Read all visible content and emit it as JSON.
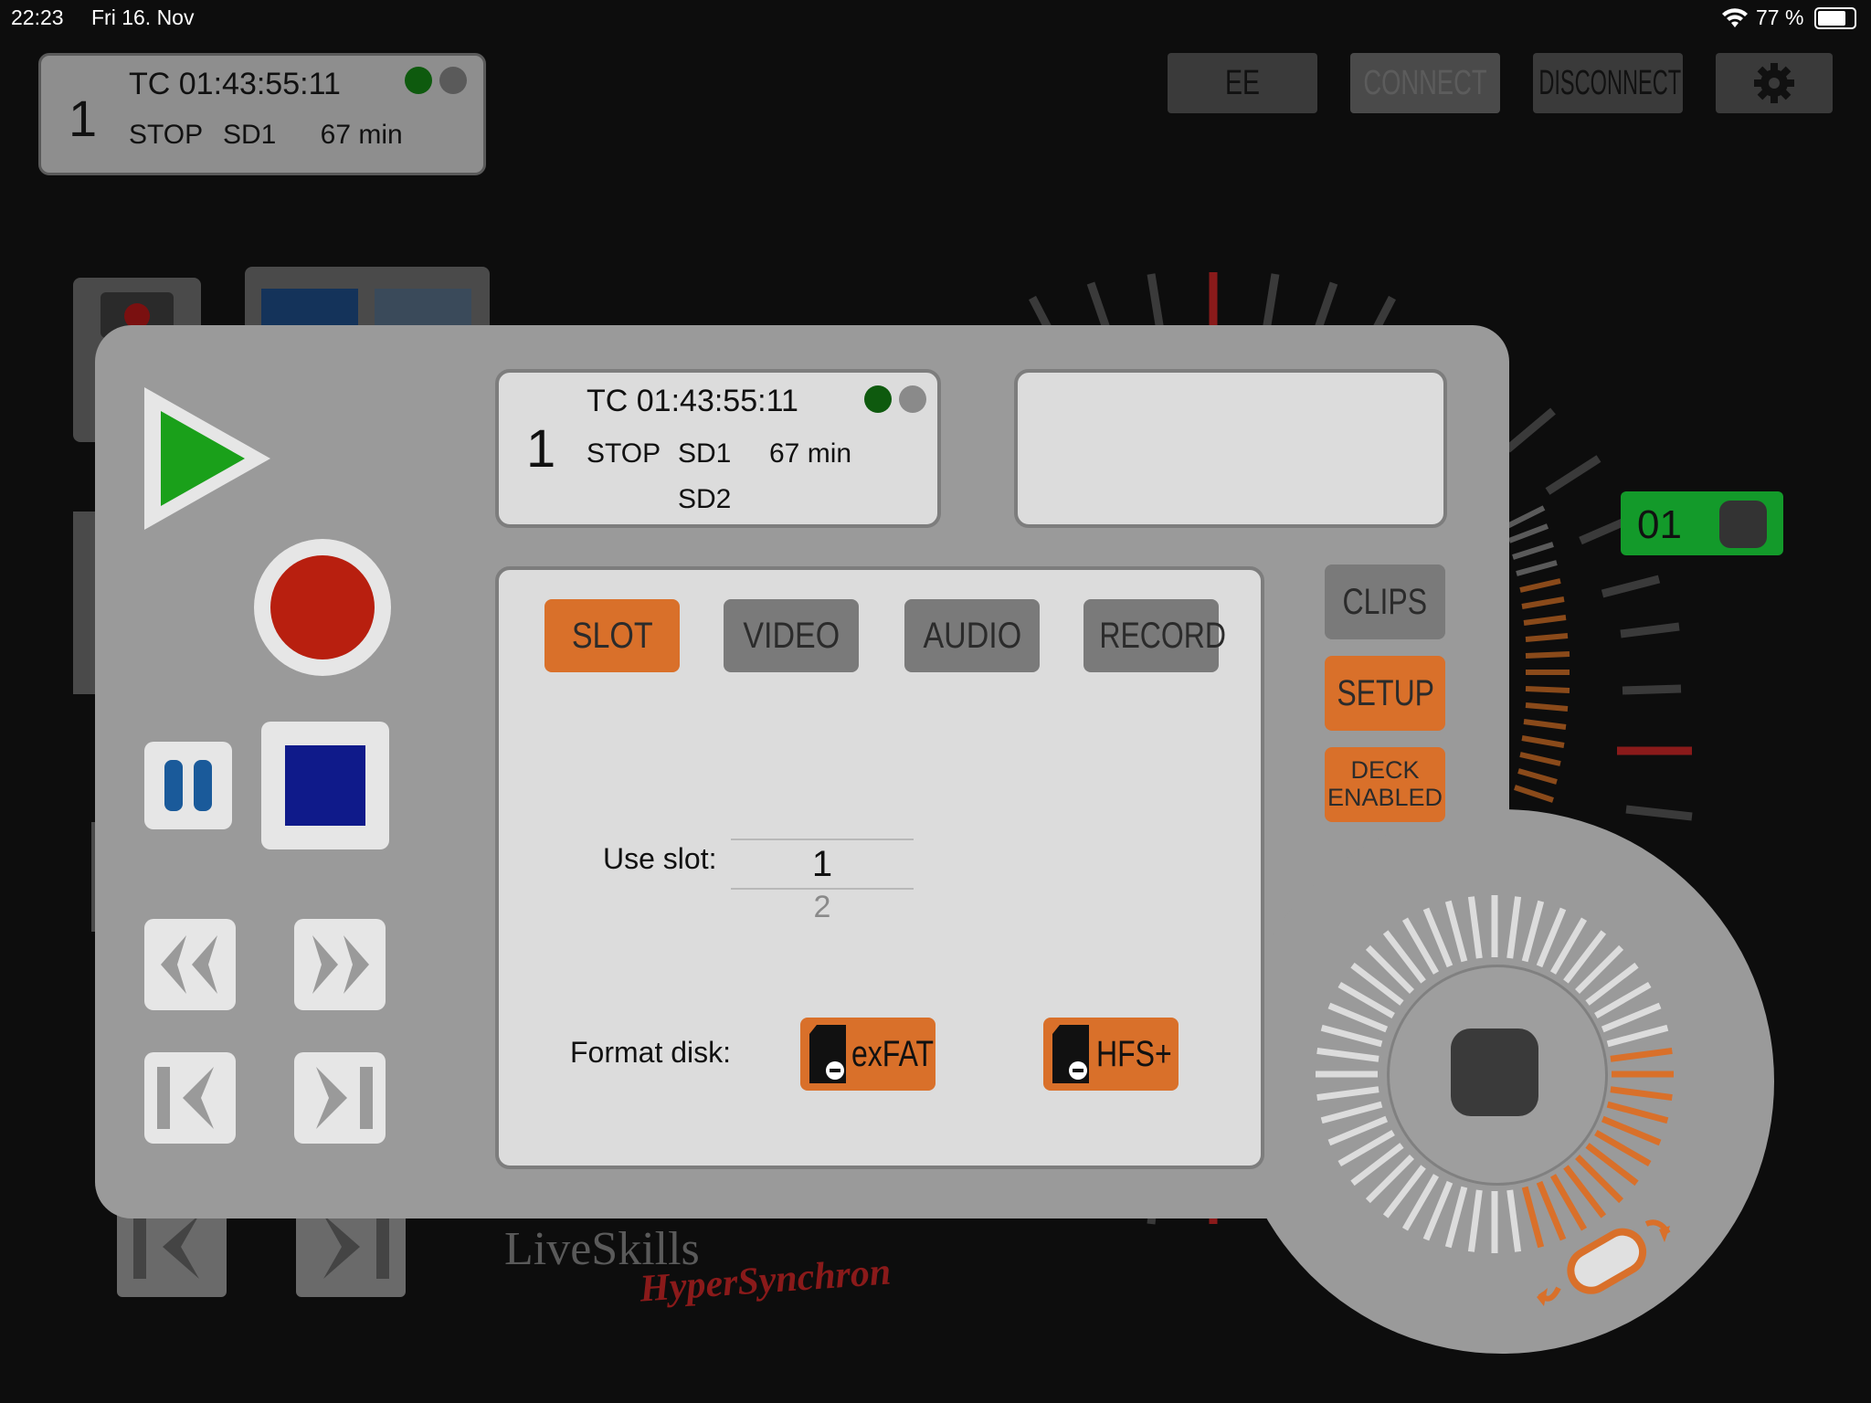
{
  "status_bar": {
    "time": "22:23",
    "date": "Fri 16. Nov",
    "battery": "77 %"
  },
  "deck_top": {
    "deck_number": "1",
    "timecode": "TC 01:43:55:11",
    "state": "STOP",
    "slot": "SD1",
    "remaining": "67 min"
  },
  "top_buttons": {
    "ee": "EE",
    "connect": "CONNECT",
    "disconnect": "DISCONNECT"
  },
  "panel": {
    "lcd": {
      "deck_number": "1",
      "timecode": "TC 01:43:55:11",
      "state": "STOP",
      "slot": "SD1",
      "remaining": "67 min",
      "slot2": "SD2"
    },
    "tabs": {
      "slot": "SLOT",
      "video": "VIDEO",
      "audio": "AUDIO",
      "record": "RECORD"
    },
    "use_slot_label": "Use slot:",
    "slot_options": [
      "1",
      "2"
    ],
    "format_disk_label": "Format disk:",
    "exfat_label": "exFAT",
    "hfs_label": "HFS+"
  },
  "side_buttons": {
    "clips": "CLIPS",
    "setup": "SETUP",
    "deck_enabled_1": "DECK",
    "deck_enabled_2": "ENABLED"
  },
  "jog_channel": "01",
  "logo": {
    "line1": "LiveSkills",
    "line2": "HyperSynchron"
  },
  "colors": {
    "accent_orange": "#d9702a",
    "play_green": "#1aa01a",
    "record_red": "#b81f0f",
    "stop_blue": "#0f1a8a",
    "status_green": "#0e5a0e",
    "channel_green": "#139a2a"
  }
}
